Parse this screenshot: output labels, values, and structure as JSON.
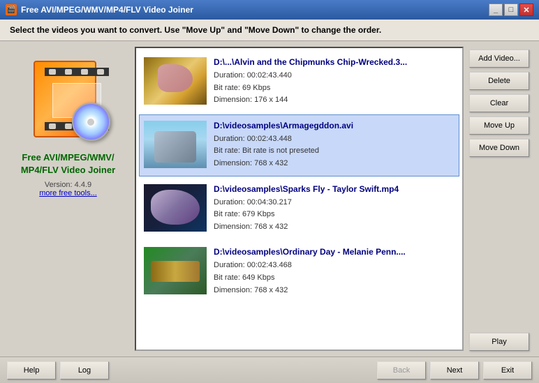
{
  "titlebar": {
    "title": "Free AVI/MPEG/WMV/MP4/FLV Video Joiner",
    "icon": "🎬"
  },
  "instruction": "Select the videos you want to convert. Use \"Move Up\" and \"Move Down\" to change the order.",
  "sidebar": {
    "app_name_line1": "Free AVI/MPEG/WMV/",
    "app_name_line2": "MP4/FLV Video Joiner",
    "version": "Version: 4.4.9",
    "more_tools": "more free tools..."
  },
  "buttons": {
    "add_video": "Add Video...",
    "delete": "Delete",
    "clear": "Clear",
    "move_up": "Move Up",
    "move_down": "Move Down",
    "play": "Play"
  },
  "videos": [
    {
      "filename": "D:\\...\\Alvin and the Chipmunks Chip-Wrecked.3...",
      "duration": "Duration: 00:02:43.440",
      "bitrate": "Bit rate: 69 Kbps",
      "dimension": "Dimension: 176 x 144",
      "selected": false,
      "thumb_class": "thumb-1"
    },
    {
      "filename": "D:\\videosamples\\Armagegddon.avi",
      "duration": "Duration: 00:02:43.448",
      "bitrate": "Bit rate: Bit rate is not preseted",
      "dimension": "Dimension: 768 x 432",
      "selected": true,
      "thumb_class": "thumb-2"
    },
    {
      "filename": "D:\\videosamples\\Sparks Fly - Taylor Swift.mp4",
      "duration": "Duration: 00:04:30.217",
      "bitrate": "Bit rate: 679 Kbps",
      "dimension": "Dimension: 768 x 432",
      "selected": false,
      "thumb_class": "thumb-3"
    },
    {
      "filename": "D:\\videosamples\\Ordinary Day - Melanie Penn....",
      "duration": "Duration: 00:02:43.468",
      "bitrate": "Bit rate: 649 Kbps",
      "dimension": "Dimension: 768 x 432",
      "selected": false,
      "thumb_class": "thumb-4"
    }
  ],
  "nav": {
    "help": "Help",
    "log": "Log",
    "back": "Back",
    "next": "Next",
    "exit": "Exit"
  }
}
